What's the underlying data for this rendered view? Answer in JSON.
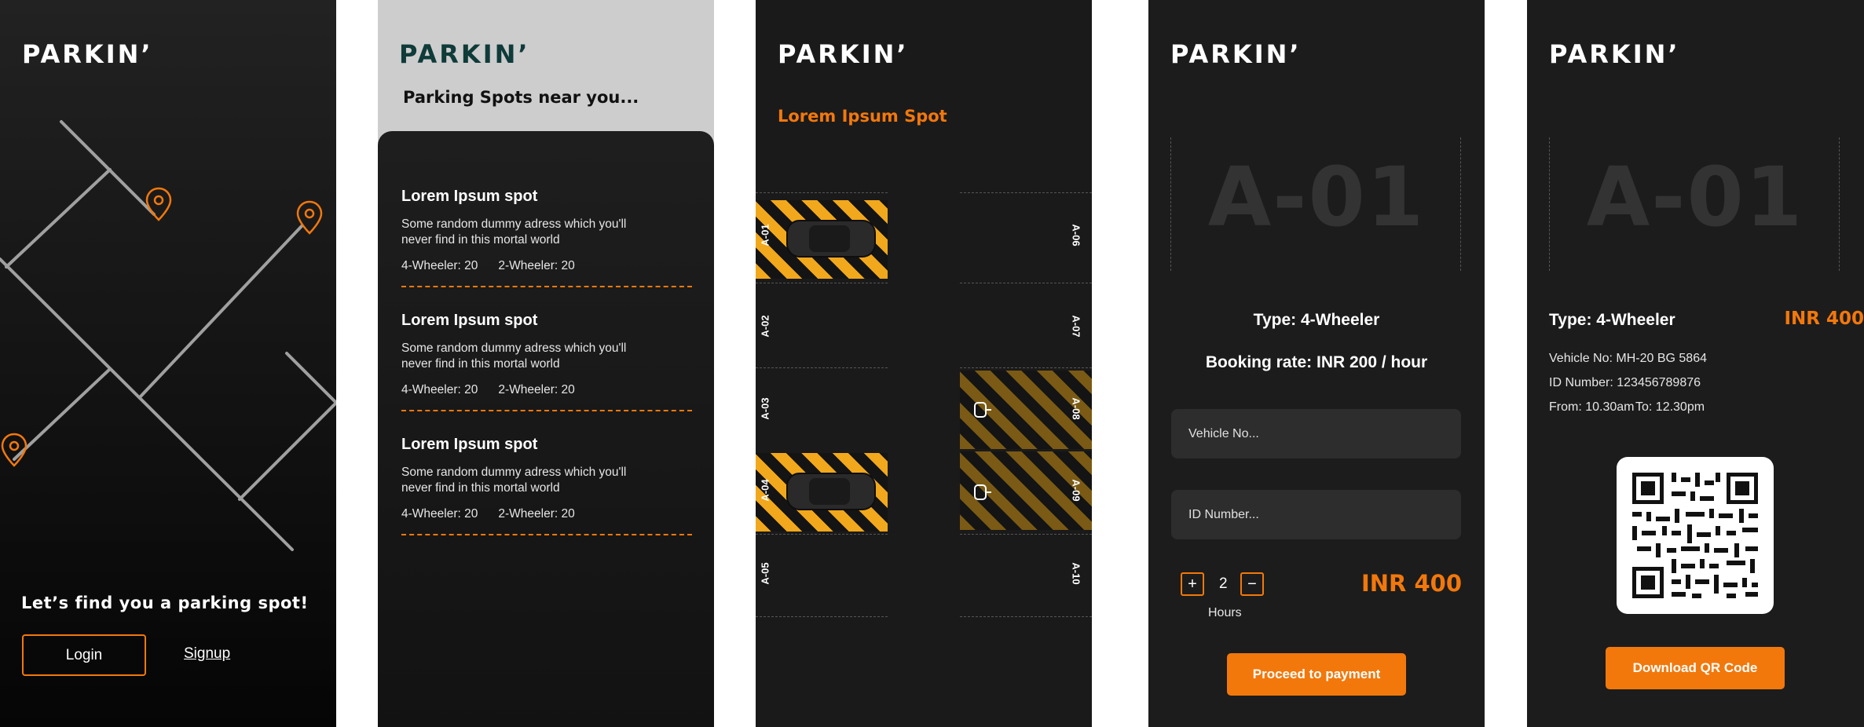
{
  "brand": "PARKIN’",
  "accent_color": "#f2780c",
  "welcome": {
    "tagline": "Let’s find you a parking spot!",
    "login_label": "Login",
    "signup_label": "Signup"
  },
  "spots_list": {
    "subtitle": "Parking Spots near you...",
    "spots": [
      {
        "title": "Lorem Ipsum spot",
        "address": "Some random dummy adress which you'll never find in this mortal world",
        "four_wheeler": "4-Wheeler: 20",
        "two_wheeler": "2-Wheeler: 20"
      },
      {
        "title": "Lorem Ipsum spot",
        "address": "Some random dummy adress which you'll never find in this mortal world",
        "four_wheeler": "4-Wheeler: 20",
        "two_wheeler": "2-Wheeler: 20"
      },
      {
        "title": "Lorem Ipsum spot",
        "address": "Some random dummy adress which you'll never find in this mortal world",
        "four_wheeler": "4-Wheeler: 20",
        "two_wheeler": "2-Wheeler: 20"
      }
    ]
  },
  "slot_map": {
    "title": "Lorem Ipsum Spot",
    "left_slots": [
      "A-01",
      "A-02",
      "A-03",
      "A-04",
      "A-05"
    ],
    "right_slots": [
      "A-06",
      "A-07",
      "A-08",
      "A-09",
      "A-10"
    ]
  },
  "booking": {
    "slot_code": "A-01",
    "type": "Type: 4-Wheeler",
    "rate": "Booking rate: INR 200 / hour",
    "vehicle_placeholder": "Vehicle No...",
    "id_placeholder": "ID Number...",
    "plus_label": "+",
    "hours_value": "2",
    "minus_label": "−",
    "hours_label": "Hours",
    "total": "INR 400",
    "proceed_label": "Proceed to payment"
  },
  "ticket": {
    "slot_code": "A-01",
    "type": "Type: 4-Wheeler",
    "total": "INR 400",
    "vehicle_no": "Vehicle No: MH-20 BG 5864",
    "id_number": "ID Number: 123456789876",
    "from": "From: 10.30am",
    "to": "To: 12.30pm",
    "download_label": "Download QR Code"
  }
}
